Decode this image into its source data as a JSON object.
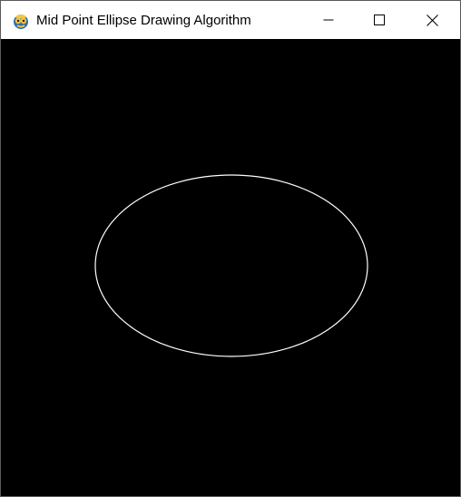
{
  "window": {
    "title": "Mid Point Ellipse Drawing Algorithm",
    "app_icon": "pygame-snake-icon",
    "controls": {
      "minimize_icon": "minimize-icon",
      "maximize_icon": "maximize-icon",
      "close_icon": "close-icon"
    }
  },
  "canvas": {
    "background_color": "#000000",
    "ellipse": {
      "stroke_color": "#ffffff"
    }
  }
}
